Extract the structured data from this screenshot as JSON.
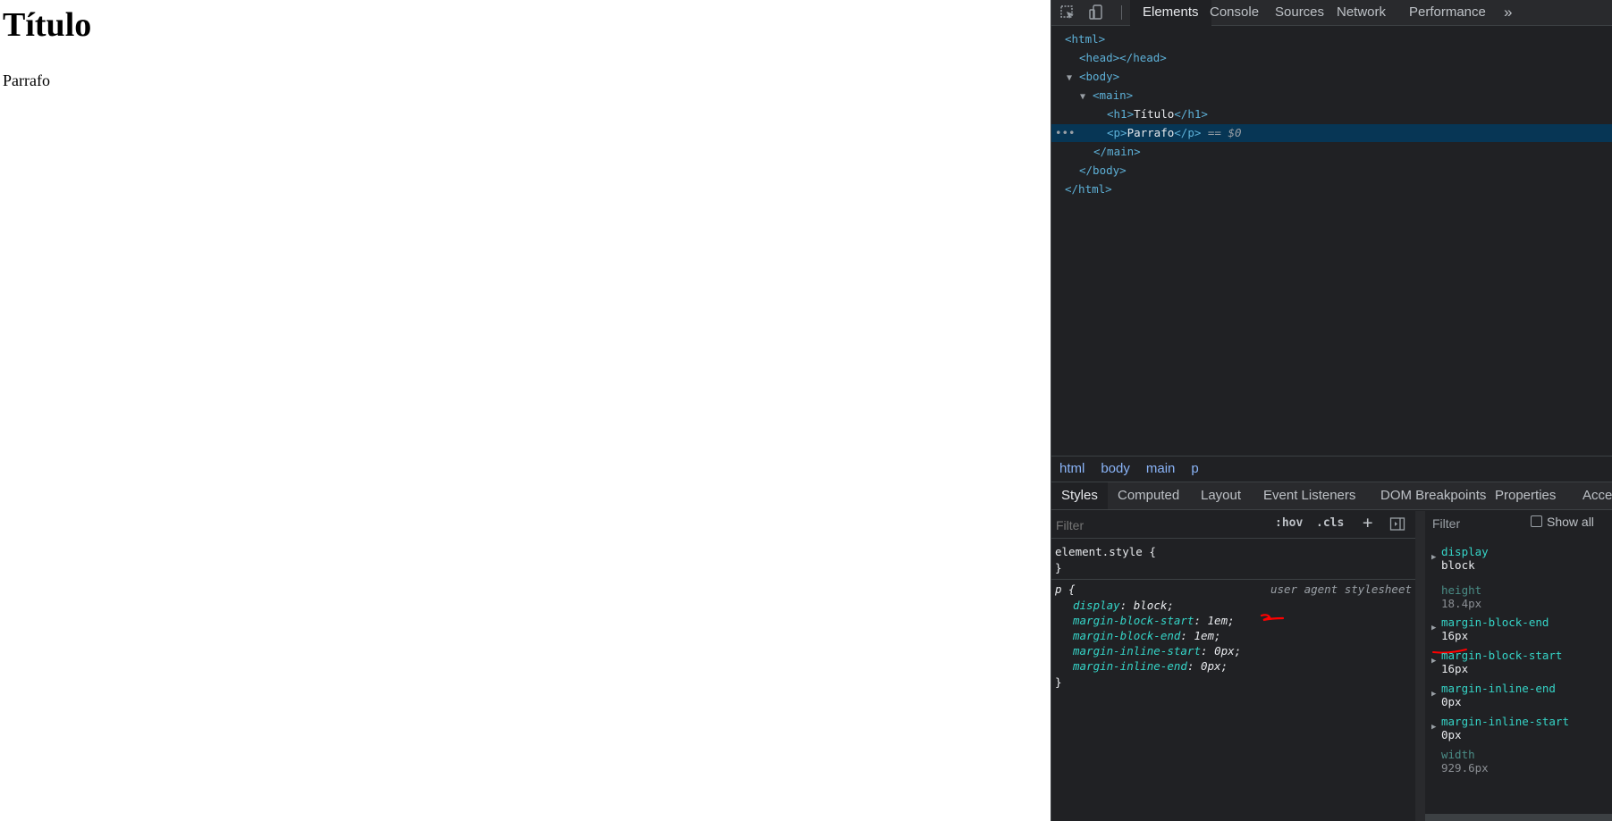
{
  "page": {
    "heading": "Título",
    "paragraph": "Parrafo"
  },
  "devtools": {
    "tabs": [
      "Elements",
      "Console",
      "Sources",
      "Network",
      "Performance"
    ],
    "more_tabs": "»",
    "dom": {
      "l1": "<html>",
      "l2": "<head></head>",
      "l3": "<body>",
      "l4": "<main>",
      "l5_open": "<h1>",
      "l5_text": "Título",
      "l5_close": "</h1>",
      "l6_open": "<p>",
      "l6_text": "Parrafo",
      "l6_close": "</p>",
      "l6_ref": "== $0",
      "l7": "</main>",
      "l8": "</body>",
      "l9": "</html>",
      "dots": "•••"
    },
    "breadcrumbs": [
      "html",
      "body",
      "main",
      "p"
    ],
    "subtabs": [
      "Styles",
      "Computed",
      "Layout",
      "Event Listeners",
      "DOM Breakpoints",
      "Properties",
      "Accessibility"
    ],
    "styles": {
      "filter_placeholder": "Filter",
      "hov": ":hov",
      "cls": ".cls",
      "plus": "+",
      "element_style_open": "element.style {",
      "brace_close": "}",
      "rule_selector": "p {",
      "rule_source": "user agent stylesheet",
      "declarations": [
        {
          "prop": "display",
          "value": "block;"
        },
        {
          "prop": "margin-block-start",
          "value": "1em;"
        },
        {
          "prop": "margin-block-end",
          "value": "1em;"
        },
        {
          "prop": "margin-inline-start",
          "value": "0px;"
        },
        {
          "prop": "margin-inline-end",
          "value": "0px;"
        }
      ]
    },
    "computed": {
      "filter_placeholder": "Filter",
      "show_all": "Show all",
      "props": [
        {
          "name": "display",
          "value": "block"
        },
        {
          "name": "height",
          "value": "18.4px"
        },
        {
          "name": "margin-block-end",
          "value": "16px"
        },
        {
          "name": "margin-block-start",
          "value": "16px"
        },
        {
          "name": "margin-inline-end",
          "value": "0px"
        },
        {
          "name": "margin-inline-start",
          "value": "0px"
        },
        {
          "name": "width",
          "value": "929.6px"
        }
      ]
    },
    "colors": {
      "panel_bg": "#202124",
      "tag": "#5db0d7",
      "prop": "#35d4c7",
      "selected_row": "#073655",
      "annotation": "#ff0000"
    }
  }
}
